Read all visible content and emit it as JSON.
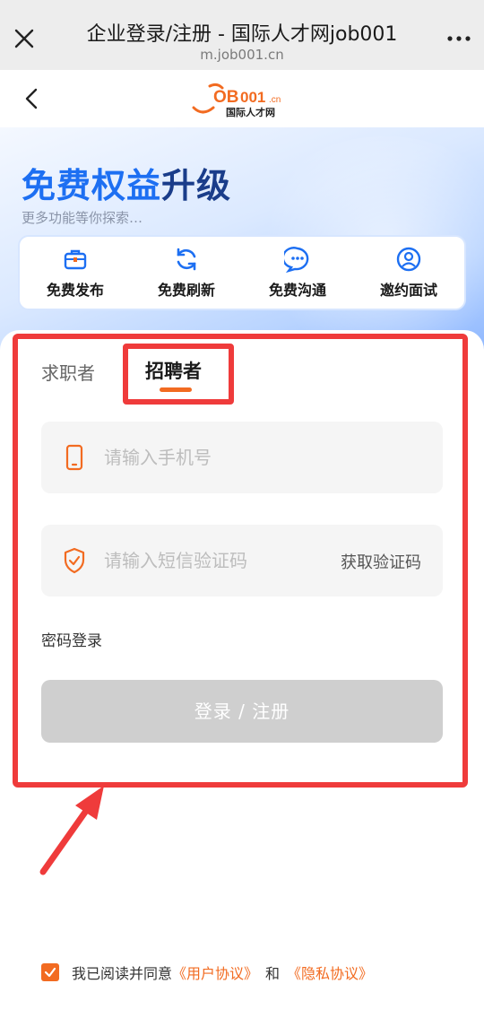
{
  "window": {
    "title": "企业登录/注册 - 国际人才网job001",
    "url": "m.job001.cn"
  },
  "header": {
    "logo_text": "JOB001.cn",
    "logo_sub": "国际人才网"
  },
  "banner": {
    "headline_part1": "免费权益",
    "headline_part2": "升级",
    "subtitle": "更多功能等你探索…",
    "features": [
      {
        "label": "免费发布",
        "icon": "briefcase-icon"
      },
      {
        "label": "免费刷新",
        "icon": "refresh-icon"
      },
      {
        "label": "免费沟通",
        "icon": "chat-icon"
      },
      {
        "label": "邀约面试",
        "icon": "user-circle-icon"
      }
    ]
  },
  "login": {
    "tabs": [
      {
        "label": "求职者",
        "active": false
      },
      {
        "label": "招聘者",
        "active": true
      }
    ],
    "phone_placeholder": "请输入手机号",
    "code_placeholder": "请输入短信验证码",
    "get_code_label": "获取验证码",
    "password_login_label": "密码登录",
    "submit_label": "登录 / 注册"
  },
  "agreement": {
    "checked": true,
    "prefix": "我已阅读并同意",
    "user_agreement": "《用户协议》",
    "and": "和",
    "privacy_policy": "《隐私协议》"
  },
  "colors": {
    "accent": "#f26b21",
    "brand_blue": "#1d6ff2",
    "highlight_red": "#ef3b3b",
    "button_disabled": "#cfcfcf"
  }
}
